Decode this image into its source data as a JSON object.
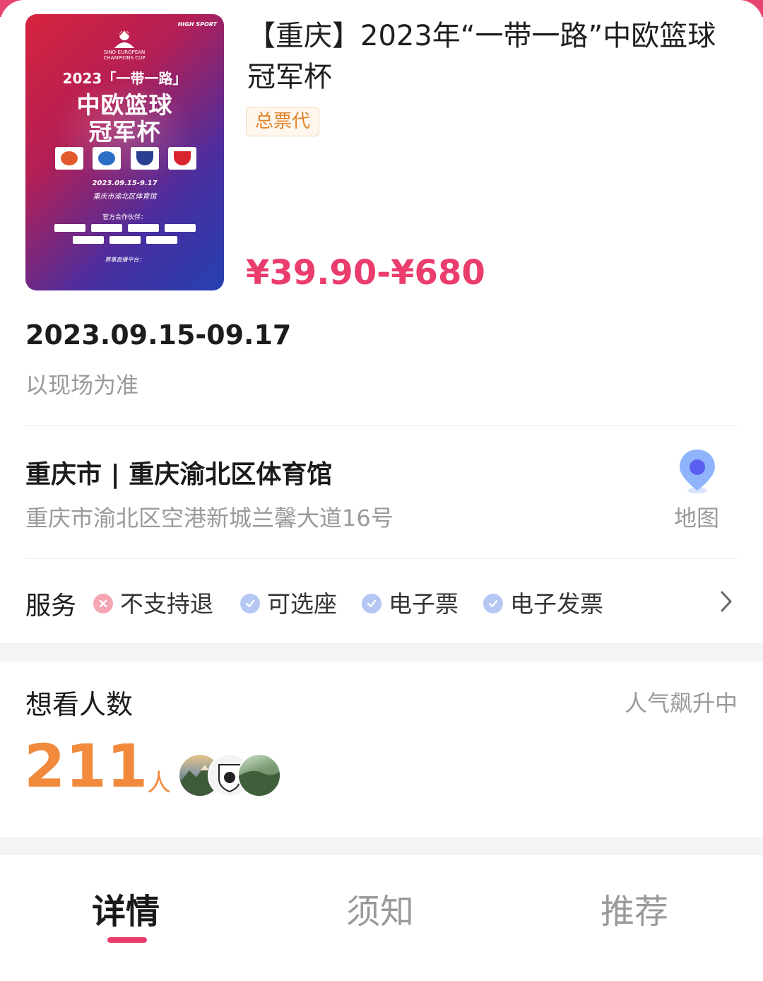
{
  "event": {
    "title": "【重庆】2023年“一带一路”中欧篮球冠军杯",
    "tag": "总票代",
    "price_min": "¥39.90",
    "price_sep": "-",
    "price_max": "¥680",
    "date": "2023.09.15-09.17",
    "date_note": "以现场为准"
  },
  "poster": {
    "brand": "HIGH SPORT",
    "logo_text": "SINO-EUROPEAN CHAMPIONS CUP",
    "line1": "2023「一带一路」",
    "line2": "中欧篮球",
    "line3": "冠军杯",
    "date": "2023.09.15-9.17",
    "venue": "重庆市渝北区体育馆",
    "partners_title": "官方合作伙伴：",
    "live": "赛事直播平台：",
    "footer": ""
  },
  "venue": {
    "name": "重庆市 | 重庆渝北区体育馆",
    "address": "重庆市渝北区空港新城兰馨大道16号",
    "map_label": "地图",
    "map_icon": "location-pin-icon"
  },
  "services": {
    "title": "服务",
    "items": [
      {
        "label": "不支持退",
        "status": "no"
      },
      {
        "label": "可选座",
        "status": "yes"
      },
      {
        "label": "电子票",
        "status": "yes"
      },
      {
        "label": "电子发票",
        "status": "yes"
      }
    ]
  },
  "want": {
    "title": "想看人数",
    "hot": "人气飙升中",
    "count": "211",
    "unit": "人"
  },
  "tabs": [
    {
      "label": "详情",
      "active": true
    },
    {
      "label": "须知",
      "active": false
    },
    {
      "label": "推荐",
      "active": false
    }
  ],
  "colors": {
    "accent": "#ea3d6e",
    "orange": "#f28a3d",
    "tag_text": "#e0842c",
    "muted": "#9a9a9a"
  }
}
